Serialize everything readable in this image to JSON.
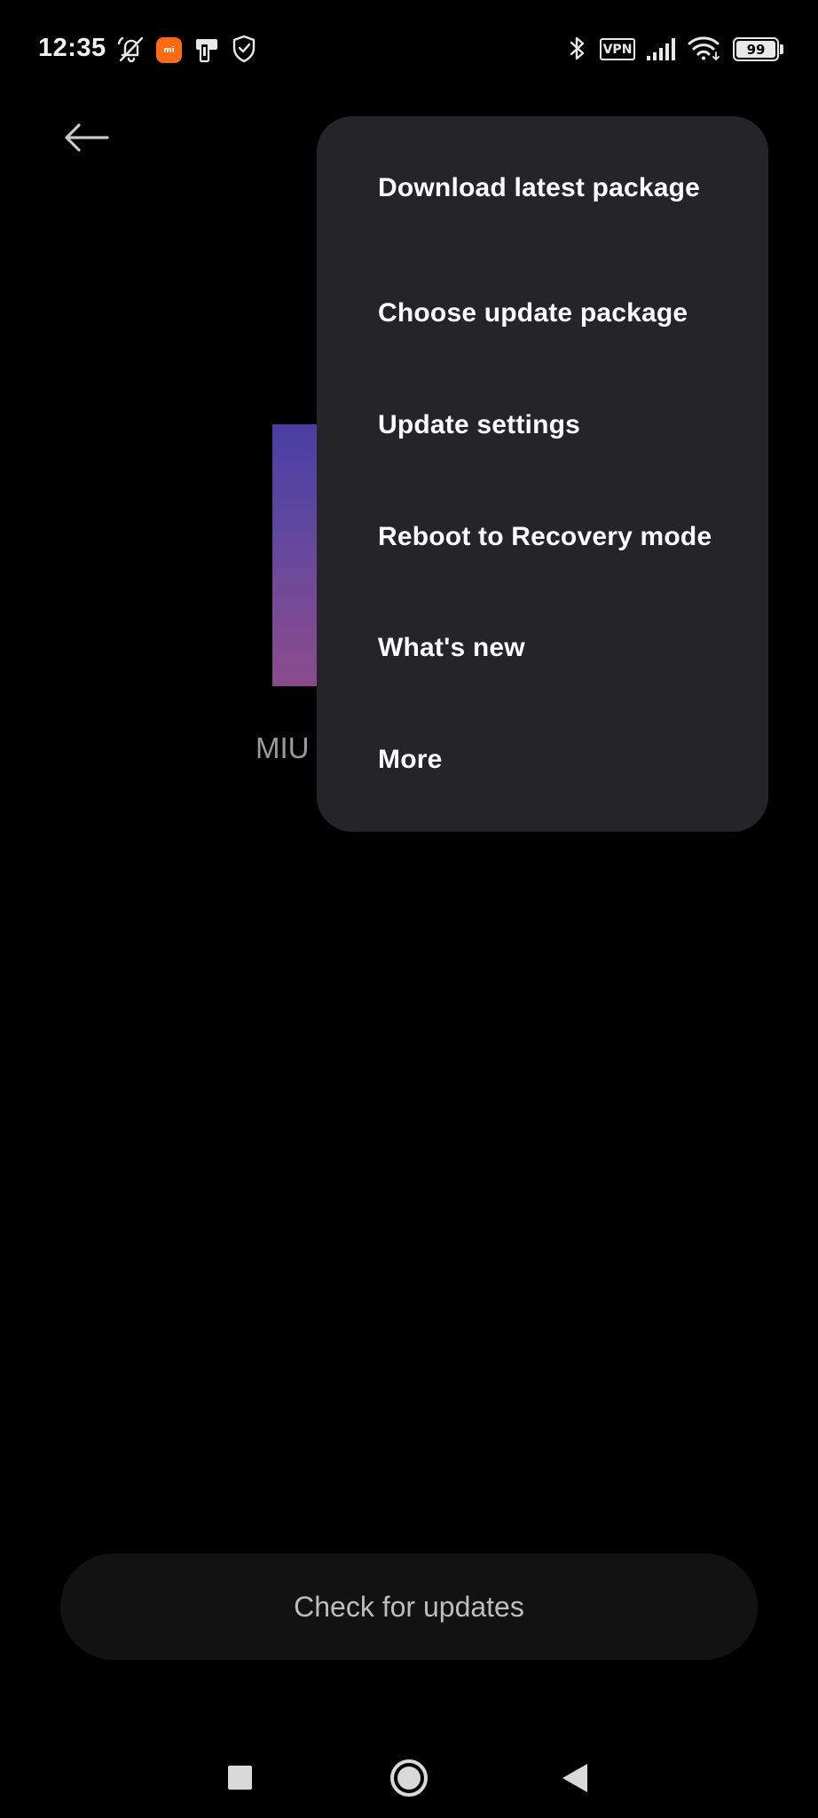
{
  "status_bar": {
    "time": "12:35",
    "icons": [
      "bell-off-icon",
      "mi-app-icon",
      "screen-cast-icon",
      "shield-check-icon",
      "bluetooth-icon",
      "vpn-icon",
      "signal-icon",
      "wifi-icon",
      "battery-icon"
    ],
    "mi_badge_text": "mi",
    "vpn_text": "VPN",
    "battery_level": "99"
  },
  "header": {
    "back_icon": "arrow-left-icon"
  },
  "background": {
    "version_label": "MIU"
  },
  "menu": {
    "items": [
      {
        "label": "Download latest package"
      },
      {
        "label": "Choose update package"
      },
      {
        "label": "Update settings"
      },
      {
        "label": "Reboot to Recovery mode"
      },
      {
        "label": "What's new"
      },
      {
        "label": "More"
      }
    ]
  },
  "actions": {
    "check_updates_label": "Check for updates"
  },
  "nav_bar": {
    "icons": [
      "recents-icon",
      "home-icon",
      "back-icon"
    ]
  },
  "colors": {
    "background": "#000000",
    "menu_background": "#252429",
    "button_background": "#121212",
    "gradient_top": "#4a3ea3",
    "gradient_bottom": "#8a4b8c",
    "mi_orange": "#ff6a13"
  }
}
